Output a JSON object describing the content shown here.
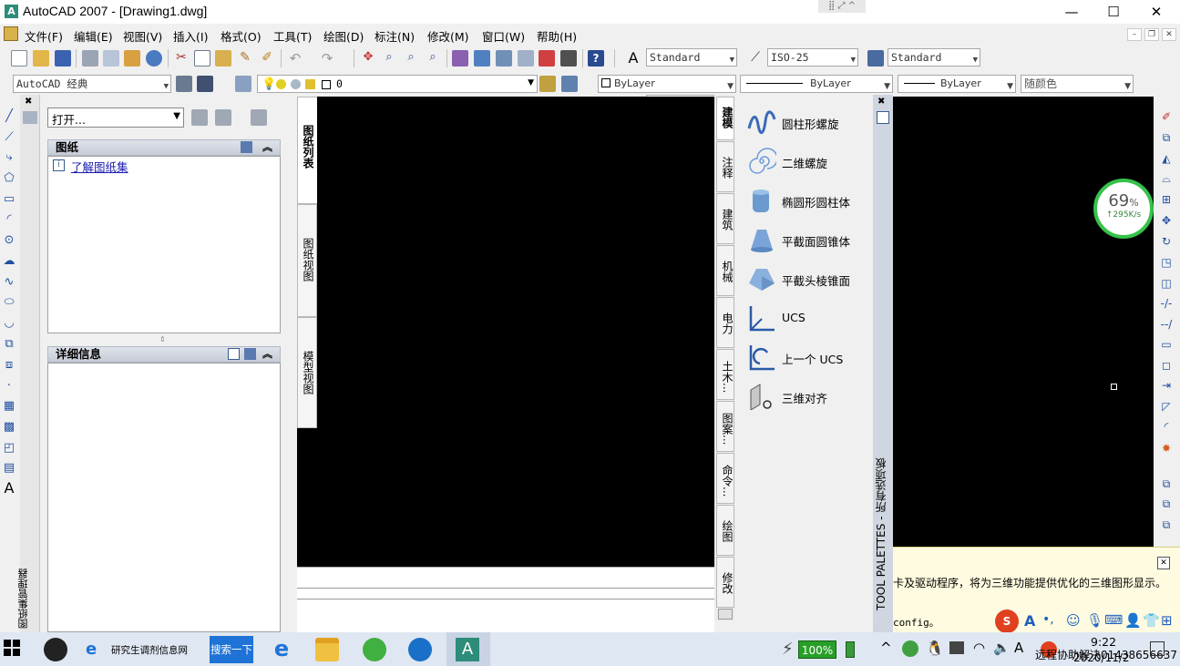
{
  "window": {
    "title": "AutoCAD 2007 - [Drawing1.dwg]",
    "minimize": "—",
    "maximize": "☐",
    "close": "✕"
  },
  "menu": [
    "文件(F)",
    "编辑(E)",
    "视图(V)",
    "插入(I)",
    "格式(O)",
    "工具(T)",
    "绘图(D)",
    "标注(N)",
    "修改(M)",
    "窗口(W)",
    "帮助(H)"
  ],
  "toolbar": {
    "text_style": "Standard",
    "dim_style": "ISO-25",
    "table_style": "Standard",
    "workspace": "AutoCAD 经典",
    "layer": "0",
    "color": "ByLayer",
    "linetype": "ByLayer",
    "lineweight": "ByLayer",
    "plot_style": "随颜色"
  },
  "sheet_set": {
    "open_label": "打开...",
    "sheets_header": "图纸",
    "learn_link": "了解图纸集",
    "details_header": "详细信息",
    "tabs": [
      "图纸列表",
      "图纸视图",
      "模型视图"
    ],
    "palette_name": "图纸集管理器"
  },
  "tool_palette": {
    "tabs": [
      "建模",
      "注释",
      "建筑",
      "机械",
      "电力",
      "土木...",
      "图案...",
      "命令...",
      "绘图",
      "修改"
    ],
    "items": [
      "圆柱形螺旋",
      "二维螺旋",
      "椭圆形圆柱体",
      "平截面圆锥体",
      "平截头棱锥面",
      "UCS",
      "上一个 UCS",
      "三维对齐"
    ],
    "title": "TOOL PALETTES - 所有选项板"
  },
  "net_widget": {
    "percent": "69",
    "unit": "%",
    "speed": "↑295K/s",
    "colors": {
      "ring": "#36c24a"
    }
  },
  "popup": {
    "message": "卡及驱动程序，将为三维功能提供优化的三维图形显示。",
    "command": "config。"
  },
  "taskbar": {
    "browser_tab": "研究生调剂信息网",
    "search_button": "搜索一下",
    "battery": "100%",
    "time": "9:22",
    "date": "2020/11/2",
    "notification": "远程协助解决01438656637"
  }
}
